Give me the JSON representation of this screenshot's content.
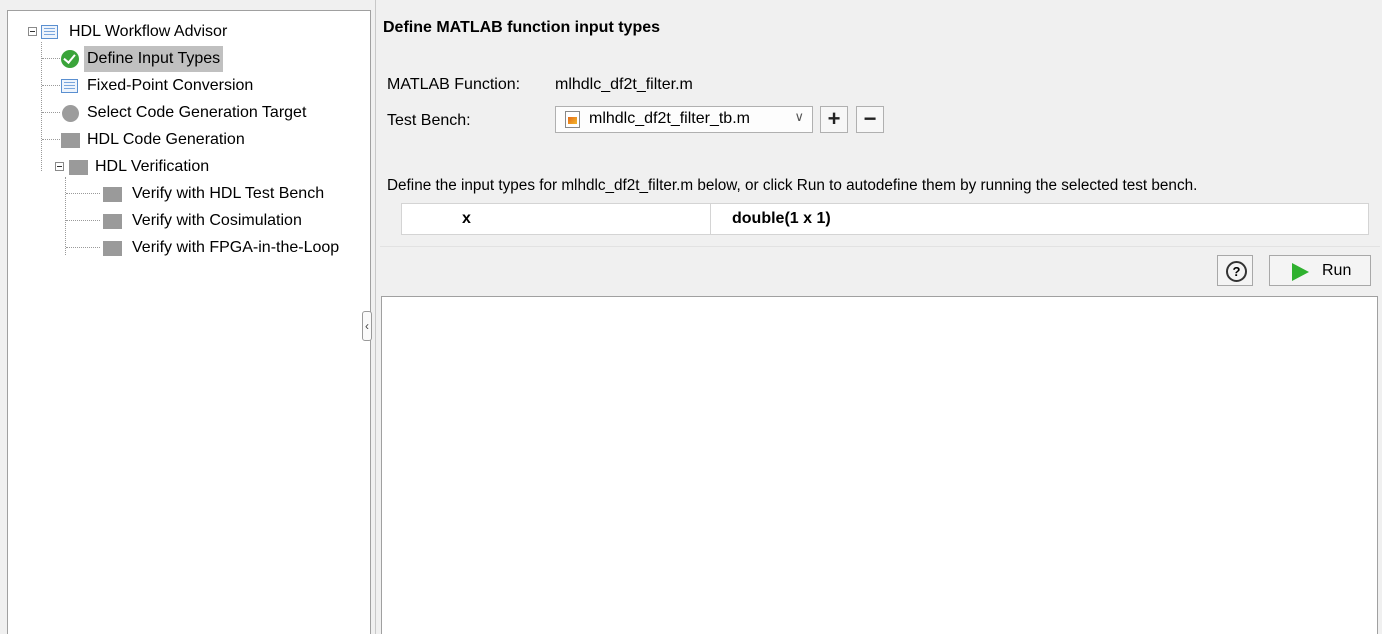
{
  "tree": {
    "root": "HDL Workflow Advisor",
    "items": [
      {
        "label": "Define Input Types",
        "icon": "check-icon",
        "status": "passed"
      },
      {
        "label": "Fixed-Point Conversion",
        "icon": "task-list-icon"
      },
      {
        "label": "Select Code Generation Target",
        "icon": "pending-circle-icon"
      },
      {
        "label": "HDL Code Generation",
        "icon": "task-gray-icon"
      },
      {
        "label": "HDL Verification",
        "icon": "task-gray-icon",
        "children": [
          {
            "label": "Verify with HDL Test Bench"
          },
          {
            "label": "Verify with Cosimulation"
          },
          {
            "label": "Verify with FPGA-in-the-Loop"
          }
        ]
      }
    ]
  },
  "main": {
    "title": "Define MATLAB function input types",
    "matlab_function_label": "MATLAB Function:",
    "matlab_function_value": "mlhdlc_df2t_filter.m",
    "test_bench_label": "Test Bench:",
    "test_bench_value": "mlhdlc_df2t_filter_tb.m",
    "add_label": "+",
    "remove_label": "−",
    "description": "Define the input types for mlhdlc_df2t_filter.m below, or click Run to autodefine them by running the selected test bench.",
    "inputs": [
      {
        "name": "x",
        "type": "double(1 x 1)"
      }
    ],
    "help_label": "?",
    "run_label": "Run"
  },
  "colors": {
    "selection": "#c0c0c0",
    "check": "#3aa43a",
    "run_play": "#2fb12f",
    "background": "#f0f0f0"
  }
}
